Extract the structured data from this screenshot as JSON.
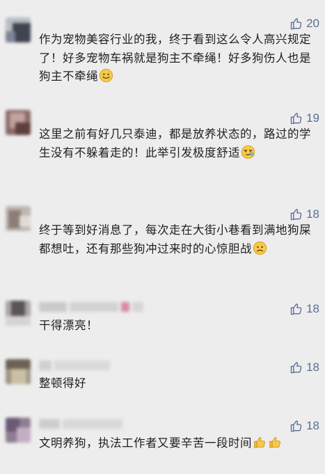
{
  "comments": [
    {
      "text": "作为宠物美容行业的我，终于看到这么令人高兴规定了！好多宠物车祸就是狗主不牵绳！好多狗伤人也是狗主不牵绳",
      "emoji": "smile-emoji",
      "likes": "20"
    },
    {
      "text": "这里之前有好几只泰迪，都是放养状态的，路过的学生没有不躲着走的！此举引发极度舒适",
      "emoji": "smug-emoji",
      "likes": "19"
    },
    {
      "text": "终于等到好消息了，每次走在大街小巷看到满地狗屎都想吐，还有那些狗冲过来时的心惊胆战",
      "emoji": "frown-emoji",
      "likes": "18"
    },
    {
      "text": "干得漂亮！",
      "emoji": "",
      "likes": "18"
    },
    {
      "text": "整顿得好",
      "emoji": "",
      "likes": "18"
    },
    {
      "text": "文明养狗，执法工作者又要辛苦一段时间",
      "emoji": "thumbs-up-emoji",
      "likes": "18"
    }
  ],
  "colors": {
    "background": "#ededed",
    "text": "#1f1f1f",
    "like": "#576b95"
  }
}
